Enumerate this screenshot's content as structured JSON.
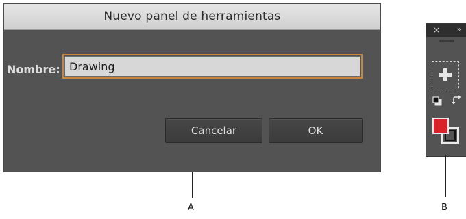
{
  "dialog": {
    "title": "Nuevo panel de herramientas",
    "name_label": "Nombre:",
    "name_value": "Drawing",
    "cancel_label": "Cancelar",
    "ok_label": "OK"
  },
  "panel": {
    "close_glyph": "×",
    "expand_glyph": "»",
    "icons": [
      "close-icon",
      "expand-icon",
      "add-icon",
      "default-colors-icon",
      "swap-colors-icon"
    ],
    "fill_color": "#d9222a",
    "stroke_color": "#111111"
  },
  "callouts": {
    "a": "A",
    "b": "B"
  },
  "colors": {
    "dialog_bg": "#535353",
    "title_bar": "#d9d9d9",
    "input_focus": "#c8843a",
    "button_bg": "#424242"
  }
}
